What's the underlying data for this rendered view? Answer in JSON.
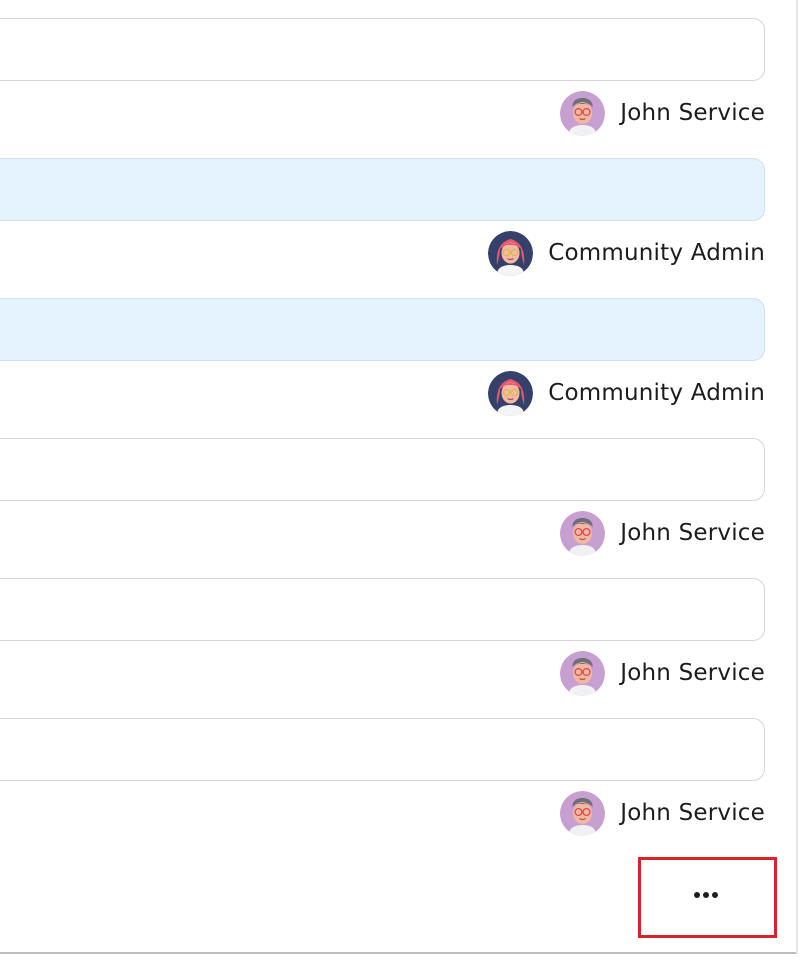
{
  "messages": [
    {
      "bubble_style": "plain",
      "author": {
        "name": "John Service",
        "avatar_icon": "john-service-avatar-icon"
      }
    },
    {
      "bubble_style": "highlighted",
      "author": {
        "name": "Community Admin",
        "avatar_icon": "community-admin-avatar-icon"
      }
    },
    {
      "bubble_style": "highlighted",
      "author": {
        "name": "Community Admin",
        "avatar_icon": "community-admin-avatar-icon"
      }
    },
    {
      "bubble_style": "plain",
      "author": {
        "name": "John Service",
        "avatar_icon": "john-service-avatar-icon"
      }
    },
    {
      "bubble_style": "plain",
      "author": {
        "name": "John Service",
        "avatar_icon": "john-service-avatar-icon"
      }
    },
    {
      "bubble_style": "plain",
      "author": {
        "name": "John Service",
        "avatar_icon": "john-service-avatar-icon"
      }
    }
  ],
  "more_button": {
    "icon": "ellipsis-icon"
  },
  "colors": {
    "highlight_bubble": "#e4f3fd",
    "plain_bubble": "#ffffff",
    "bubble_border": "#d6d6d6",
    "focus_outline": "#d9222a"
  }
}
